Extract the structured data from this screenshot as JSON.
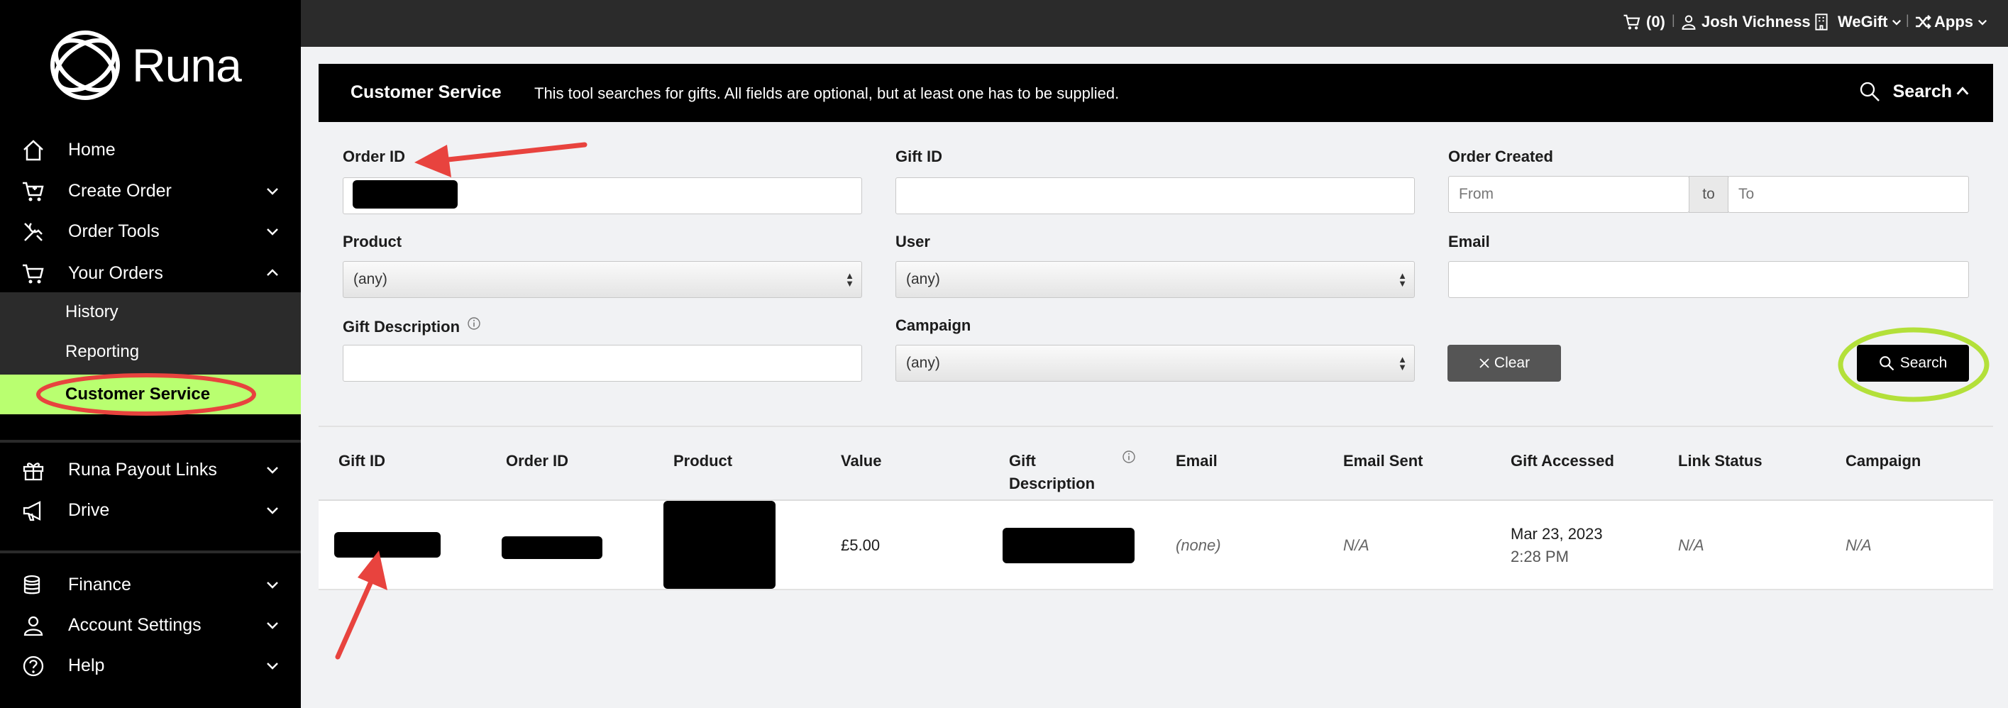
{
  "brand": {
    "name": "Runa"
  },
  "sidebar": {
    "items": [
      {
        "label": "Home"
      },
      {
        "label": "Create Order"
      },
      {
        "label": "Order Tools"
      },
      {
        "label": "Your Orders"
      },
      {
        "label": "Runa Payout Links"
      },
      {
        "label": "Drive"
      },
      {
        "label": "Finance"
      },
      {
        "label": "Account Settings"
      },
      {
        "label": "Help"
      }
    ],
    "sub_items": [
      {
        "label": "History"
      },
      {
        "label": "Reporting"
      },
      {
        "label": "Customer Service"
      }
    ]
  },
  "topbar": {
    "cart_count": "(0)",
    "user_name": "Josh Vichness",
    "org": "WeGift",
    "apps": "Apps"
  },
  "panel": {
    "title": "Customer Service",
    "description": "This tool searches for gifts. All fields are optional, but at least one has to be supplied.",
    "search_toggle": "Search"
  },
  "form": {
    "order_id_label": "Order ID",
    "gift_id_label": "Gift ID",
    "order_created_label": "Order Created",
    "from_placeholder": "From",
    "to_sep": "to",
    "to_placeholder": "To",
    "product_label": "Product",
    "product_value": "(any)",
    "user_label": "User",
    "user_value": "(any)",
    "email_label": "Email",
    "gift_description_label": "Gift Description",
    "campaign_label": "Campaign",
    "campaign_value": "(any)",
    "clear_label": "Clear",
    "search_label": "Search"
  },
  "table": {
    "headers": [
      "Gift ID",
      "Order ID",
      "Product",
      "Value",
      "Gift",
      "Description",
      "Email",
      "Email Sent",
      "Gift Accessed",
      "Link Status",
      "Campaign"
    ],
    "row": {
      "value": "£5.00",
      "email": "(none)",
      "email_sent": "N/A",
      "gift_accessed_date": "Mar 23, 2023",
      "gift_accessed_time": "2:28 PM",
      "link_status": "N/A",
      "campaign": "N/A"
    }
  },
  "colors": {
    "accent_green": "#b9ff70",
    "annotation_red": "#e8433e",
    "annotation_green": "#b3e03a"
  }
}
